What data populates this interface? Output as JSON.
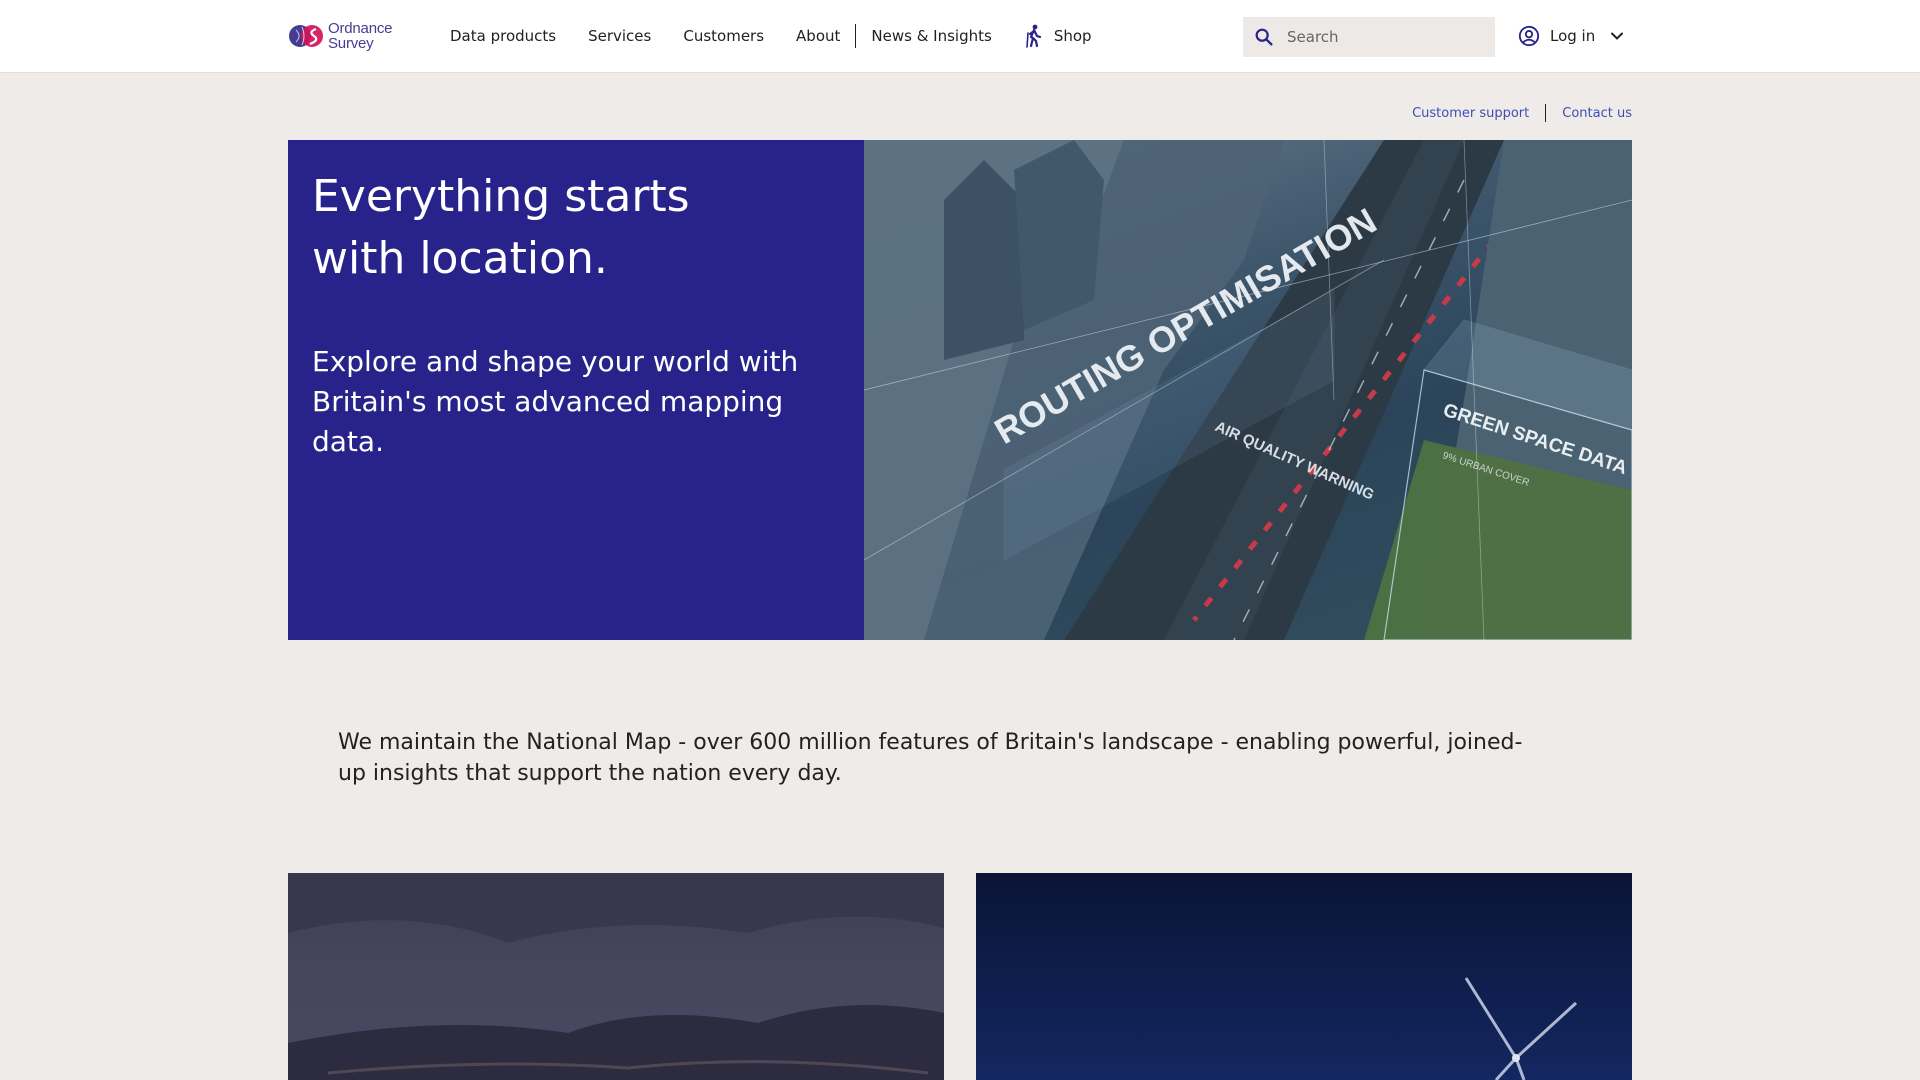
{
  "header": {
    "logo": {
      "line1": "Ordnance",
      "line2": "Survey"
    },
    "nav": {
      "items": [
        "Data products",
        "Services",
        "Customers",
        "About",
        "News & Insights"
      ],
      "shop_label": "Shop"
    },
    "search": {
      "placeholder": "Search",
      "value": ""
    },
    "login": {
      "label": "Log in"
    }
  },
  "utility_links": {
    "customer_support": "Customer support",
    "contact_us": "Contact us"
  },
  "hero": {
    "title": "Everything starts with location.",
    "subtitle": "Explore and shape your world with Britain's most advanced mapping data.",
    "image_labels": {
      "routing": "ROUTING OPTIMISATION",
      "air_quality": "AIR QUALITY WARNING",
      "green_space": "GREEN SPACE DATA",
      "urban_cover": "9% URBAN COVER"
    }
  },
  "intro": {
    "text": "We maintain the National Map - over 600 million features of Britain's landscape - enabling powerful, joined-up insights that support the nation every day."
  },
  "colors": {
    "brand_navy": "#28238b",
    "link_blue": "#3d4fb5",
    "page_bg": "#efebe8",
    "logo_magenta": "#d4145a",
    "logo_purple": "#453c90"
  },
  "icons": {
    "logo": "os-logo-mark",
    "shop": "hiker-icon",
    "search": "search-icon",
    "login": "account-circle-icon",
    "login_menu": "chevron-down-icon"
  }
}
